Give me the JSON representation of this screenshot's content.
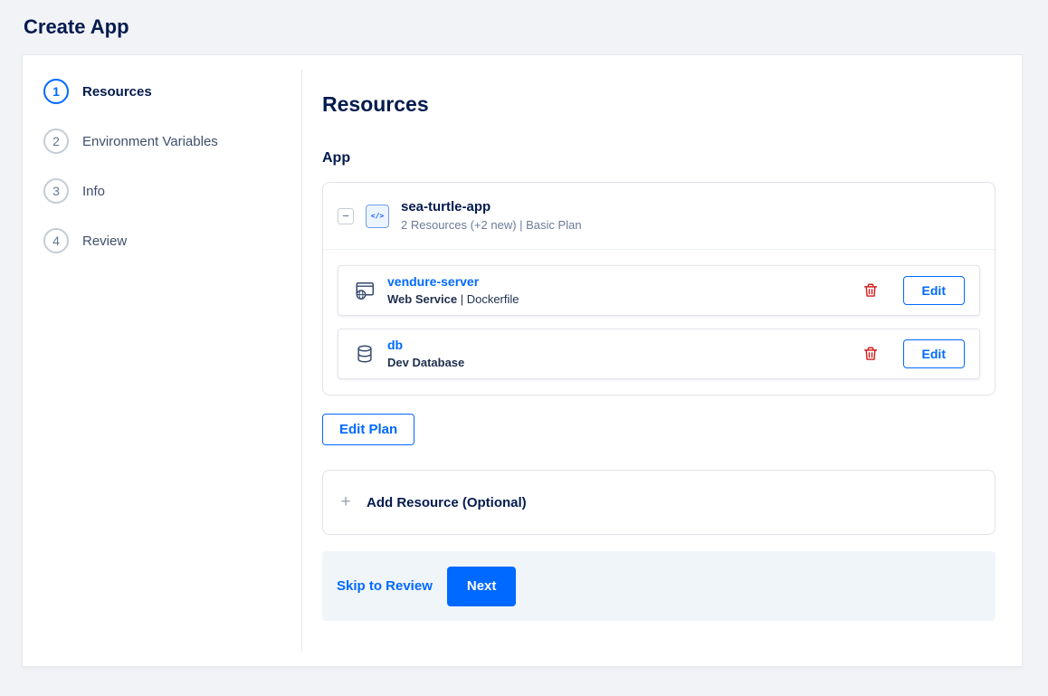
{
  "colors": {
    "accent": "#0069ff",
    "danger": "#d21e1e",
    "heading": "#031b4e"
  },
  "header": {
    "title": "Create App"
  },
  "stepper": {
    "steps": [
      {
        "number": "1",
        "label": "Resources"
      },
      {
        "number": "2",
        "label": "Environment Variables"
      },
      {
        "number": "3",
        "label": "Info"
      },
      {
        "number": "4",
        "label": "Review"
      }
    ]
  },
  "content": {
    "heading": "Resources",
    "section_label": "App",
    "app": {
      "collapse_glyph": "−",
      "icon": "code-icon",
      "icon_glyph": "</>",
      "name": "sea-turtle-app",
      "meta": "2 Resources (+2 new) | Basic Plan"
    },
    "resources": [
      {
        "icon": "web-service-icon",
        "name": "vendure-server",
        "type": "Web Service",
        "detail": "| Dockerfile",
        "edit_label": "Edit"
      },
      {
        "icon": "database-icon",
        "name": "db",
        "type": "Dev Database",
        "detail": "",
        "edit_label": "Edit"
      }
    ],
    "edit_plan_label": "Edit Plan",
    "add_resource": {
      "icon_glyph": "+",
      "label": "Add Resource (Optional)"
    },
    "footer": {
      "skip_label": "Skip to Review",
      "next_label": "Next"
    }
  }
}
